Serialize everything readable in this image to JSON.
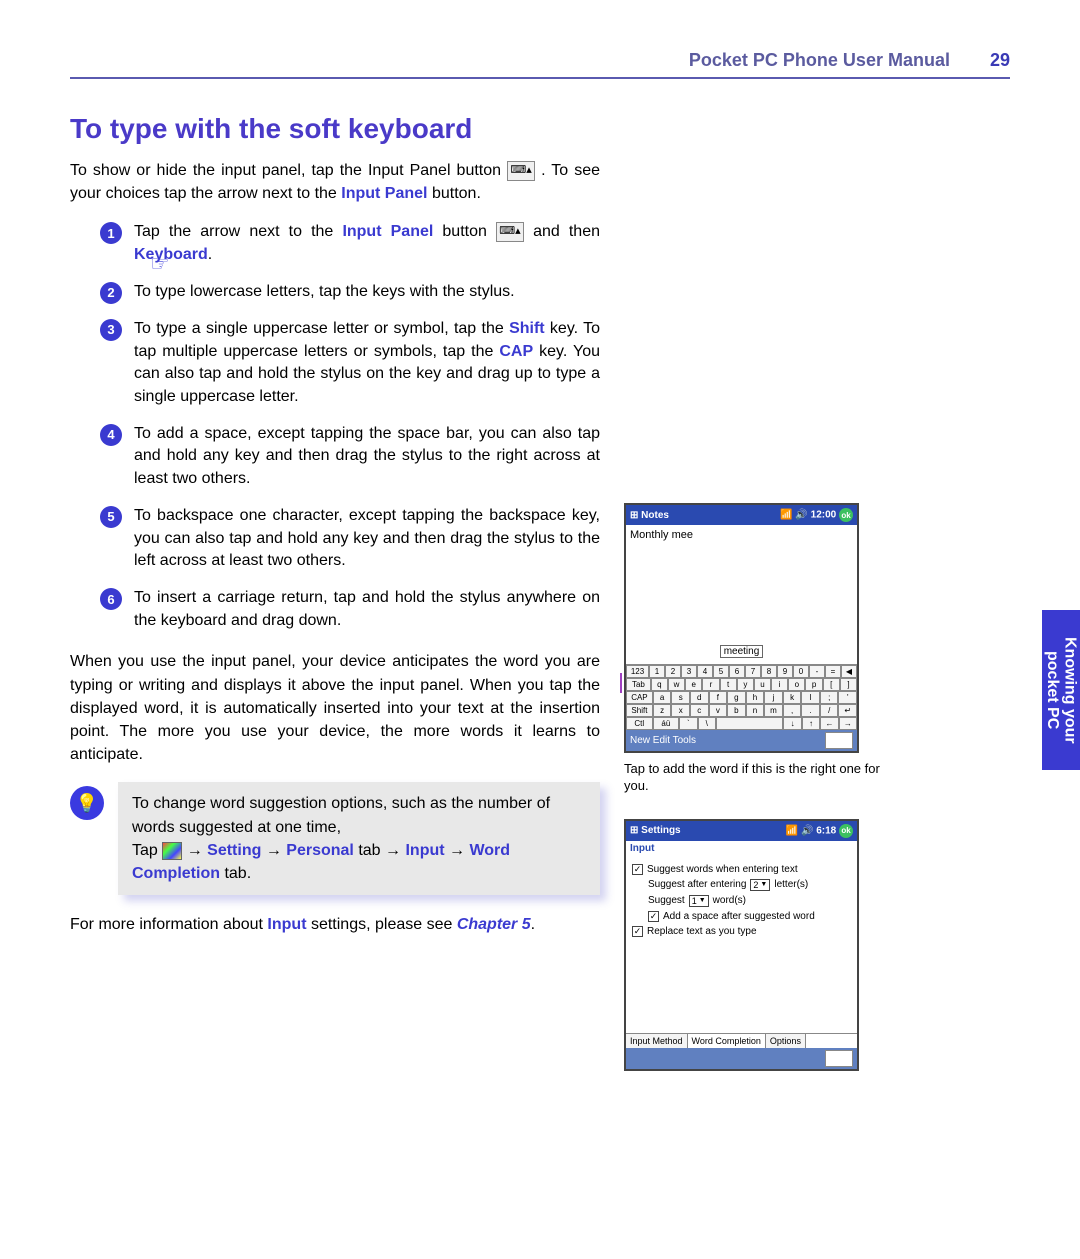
{
  "header": {
    "title": "Pocket PC Phone User Manual",
    "page": "29"
  },
  "section_title": "To type with the soft keyboard",
  "intro": {
    "p1a": "To show or hide the input panel, tap the Input Panel button ",
    "p1b": " . To see your choices tap the arrow next to the ",
    "kw_input_panel": "Input Panel",
    "p1c": " button."
  },
  "steps": [
    {
      "n": "1",
      "pre": "Tap the arrow next to the ",
      "kw1": "Input Panel",
      "mid": " button ",
      "post": " and then ",
      "kw2": "Keyboard",
      "end": "."
    },
    {
      "n": "2",
      "txt": "To type lowercase letters, tap the keys with the stylus."
    },
    {
      "n": "3",
      "pre": "To type a single uppercase letter or symbol, tap the ",
      "kw1": "Shift",
      "mid": " key. To tap multiple uppercase letters or symbols, tap the ",
      "kw2": "CAP",
      "post": " key.  You can also tap and hold the stylus on the key and drag up to type a single uppercase letter."
    },
    {
      "n": "4",
      "txt": "To add a space, except tapping the space bar, you can also tap and hold any key and then drag the stylus to the right across at least two others."
    },
    {
      "n": "5",
      "txt": "To backspace one character, except tapping the backspace key, you can also tap and hold any key and then drag the stylus to the left across at least two others."
    },
    {
      "n": "6",
      "txt": "To insert a carriage return, tap and hold the stylus anywhere on the keyboard and drag down."
    }
  ],
  "paragraph2": "When you use the input panel, your device anticipates the word you are typing or writing and displays it above the input panel. When you tap the displayed word, it is automatically inserted into your text at the insertion point. The more you use your device, the more words it learns to anticipate.",
  "tip": {
    "line1": "To change word suggestion options, such as the number of  words suggested at one time,",
    "tap": "Tap ",
    "arrow": " → ",
    "kw_setting": "Setting",
    "kw_personal": "Personal",
    "tab_word": " tab → ",
    "kw_input": "Input",
    "kw_wordcomp": "Word Completion",
    "tab_end": " tab."
  },
  "footer_para": {
    "pre": "For more information about ",
    "kw": "Input",
    "mid": " settings, please see ",
    "chapter": "Chapter 5",
    "end": "."
  },
  "side_tab": "Knowing your pocket PC",
  "notes_device": {
    "app": "Notes",
    "time": "12:00",
    "typed": "Monthly mee",
    "suggestion": "meeting",
    "kb_rows": [
      [
        "123",
        "1",
        "2",
        "3",
        "4",
        "5",
        "6",
        "7",
        "8",
        "9",
        "0",
        "-",
        "=",
        "◀"
      ],
      [
        "Tab",
        "q",
        "w",
        "e",
        "r",
        "t",
        "y",
        "u",
        "i",
        "o",
        "p",
        "[",
        "]"
      ],
      [
        "CAP",
        "a",
        "s",
        "d",
        "f",
        "g",
        "h",
        "j",
        "k",
        "l",
        ";",
        "'"
      ],
      [
        "Shift",
        "z",
        "x",
        "c",
        "v",
        "b",
        "n",
        "m",
        ",",
        ".",
        "/",
        "↵"
      ],
      [
        "Ctl",
        "áü",
        "`",
        "\\",
        " ",
        "↓",
        "↑",
        "←",
        "→"
      ]
    ],
    "footer": "New Edit Tools",
    "caption": "Tap to add the word if this is the right one for you."
  },
  "settings_device": {
    "app": "Settings",
    "time": "6:18",
    "subtitle": "Input",
    "opts": {
      "suggest_words": "Suggest words when entering text",
      "suggest_after_pre": "Suggest after entering",
      "suggest_after_val": "2",
      "suggest_after_post": "letter(s)",
      "suggest_n_pre": "Suggest",
      "suggest_n_val": "1",
      "suggest_n_post": "word(s)",
      "add_space": "Add a space after suggested word",
      "replace": "Replace text as you type"
    },
    "tabs": [
      "Input Method",
      "Word Completion",
      "Options"
    ]
  },
  "icons": {
    "input_panel": "⌨▴",
    "start": "⊞"
  }
}
